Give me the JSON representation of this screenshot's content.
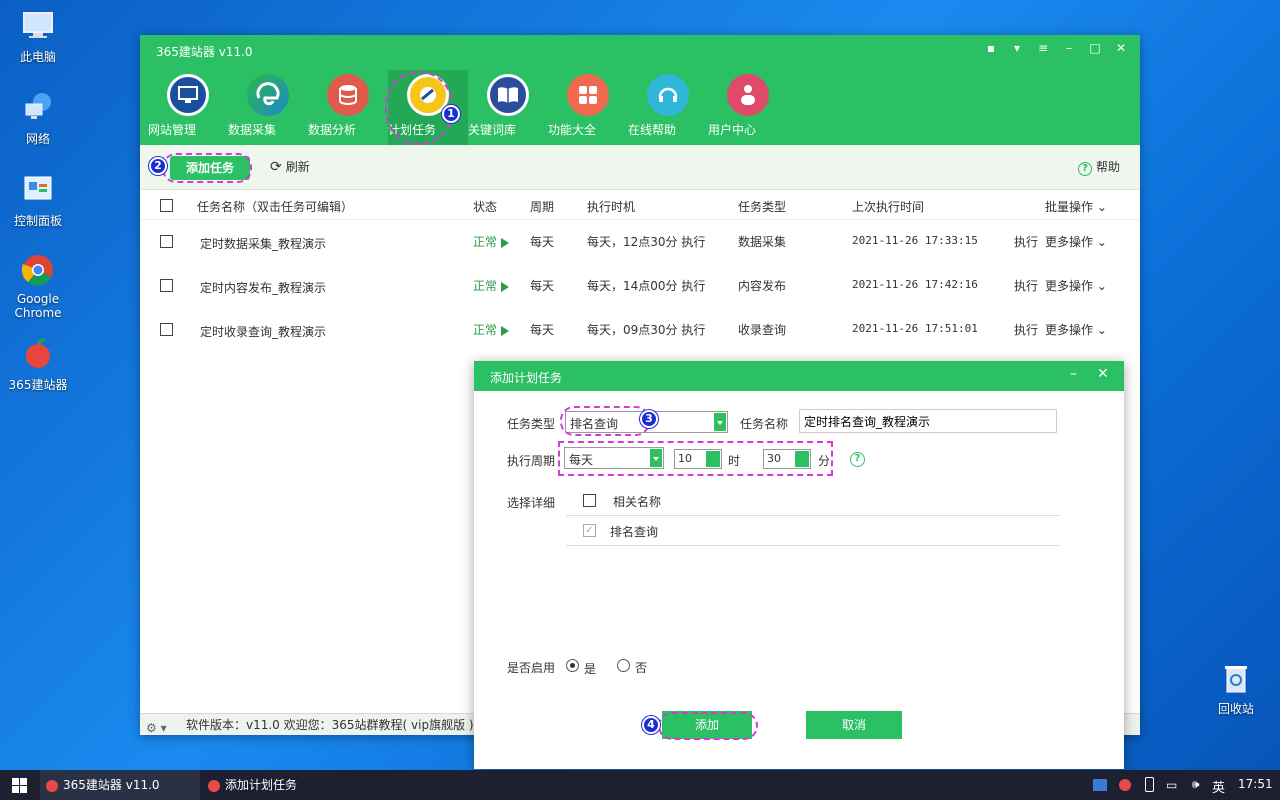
{
  "desktop": {
    "icons": [
      {
        "label": "此电脑"
      },
      {
        "label": "网络"
      },
      {
        "label": "控制面板"
      },
      {
        "label": "Google Chrome"
      },
      {
        "label": "365建站器"
      },
      {
        "label": "回收站"
      }
    ]
  },
  "window": {
    "title": "365建站器 v11.0",
    "nav": [
      {
        "label": "网站管理",
        "color": "#1a4fa0"
      },
      {
        "label": "数据采集",
        "color": "#1e88c8"
      },
      {
        "label": "数据分析",
        "color": "#e05b4b"
      },
      {
        "label": "计划任务",
        "color": "#f5c518"
      },
      {
        "label": "关键词库",
        "color": "#2a4d9c"
      },
      {
        "label": "功能大全",
        "color": "#f06a50"
      },
      {
        "label": "在线帮助",
        "color": "#2fb6d8"
      },
      {
        "label": "用户中心",
        "color": "#e04a6a"
      }
    ],
    "toolbar": {
      "add": "添加任务",
      "refresh": "刷新",
      "help": "帮助"
    },
    "table": {
      "headers": {
        "name": "任务名称（双击任务可编辑）",
        "status": "状态",
        "cycle": "周期",
        "time": "执行时机",
        "type": "任务类型",
        "last": "上次执行时间",
        "batch": "批量操作"
      },
      "rows": [
        {
          "name": "定时数据采集_教程演示",
          "status": "正常",
          "cycle": "每天",
          "time": "每天，12点30分 执行",
          "type": "数据采集",
          "last": "2021-11-26 17:33:15",
          "run": "执行",
          "more": "更多操作"
        },
        {
          "name": "定时内容发布_教程演示",
          "status": "正常",
          "cycle": "每天",
          "time": "每天，14点00分 执行",
          "type": "内容发布",
          "last": "2021-11-26 17:42:16",
          "run": "执行",
          "more": "更多操作"
        },
        {
          "name": "定时收录查询_教程演示",
          "status": "正常",
          "cycle": "每天",
          "time": "每天，09点30分 执行",
          "type": "收录查询",
          "last": "2021-11-26 17:51:01",
          "run": "执行",
          "more": "更多操作"
        }
      ]
    },
    "statusbar": "软件版本：v11.0  欢迎您：365站群教程( vip旗舰版 )"
  },
  "dialog": {
    "title": "添加计划任务",
    "task_type_label": "任务类型",
    "task_type_value": "排名查询",
    "task_name_label": "任务名称",
    "task_name_value": "定时排名查询_教程演示",
    "cycle_label": "执行周期",
    "cycle_value": "每天",
    "hour_value": "10",
    "hour_unit": "时",
    "minute_value": "30",
    "minute_unit": "分",
    "detail_label": "选择详细",
    "detail_header": "相关名称",
    "detail_items": [
      "排名查询"
    ],
    "enable_label": "是否启用",
    "enable_yes": "是",
    "enable_no": "否",
    "add_button": "添加",
    "cancel_button": "取消"
  },
  "annotations": [
    "1",
    "2",
    "3",
    "4"
  ],
  "taskbar": {
    "items": [
      "365建站器 v11.0",
      "添加计划任务"
    ],
    "ime": "英",
    "clock": "17:51"
  }
}
